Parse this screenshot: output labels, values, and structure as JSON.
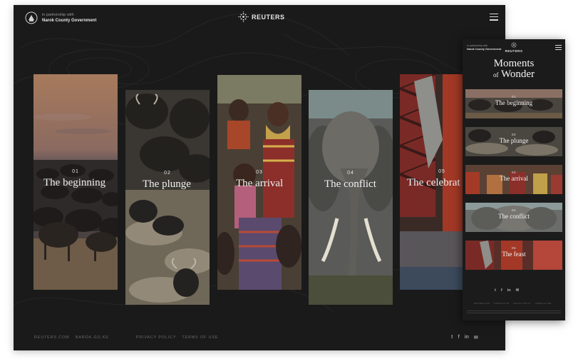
{
  "desktop": {
    "partner": {
      "line1": "in partnership with",
      "line2": "Narok County Government"
    },
    "brand": "REUTERS",
    "cards": [
      {
        "num": "01",
        "title": "The beginning"
      },
      {
        "num": "02",
        "title": "The plunge"
      },
      {
        "num": "03",
        "title": "The arrival"
      },
      {
        "num": "04",
        "title": "The conflict"
      },
      {
        "num": "05",
        "title": "The celebrat"
      }
    ],
    "footer": {
      "link1": "REUTERS.COM",
      "link2": "NAROK.GO.KE",
      "link3": "PRIVACY POLICY",
      "link4": "TERMS OF USE"
    },
    "social": {
      "twitter": "t",
      "facebook": "f",
      "linkedin": "in",
      "email": "✉"
    }
  },
  "mobile": {
    "partner": {
      "line1": "in partnership with",
      "line2": "Narok County Government"
    },
    "brand": "REUTERS",
    "title_line1": "Moments",
    "title_of": "of",
    "title_line2": "Wonder",
    "cards": [
      {
        "num": "01",
        "title": "The beginning"
      },
      {
        "num": "02",
        "title": "The plunge"
      },
      {
        "num": "03",
        "title": "The arrival"
      },
      {
        "num": "04",
        "title": "The conflict"
      },
      {
        "num": "05",
        "title": "The feast"
      }
    ],
    "social": {
      "twitter": "t",
      "facebook": "f",
      "linkedin": "in",
      "email": "✉"
    },
    "footer": {
      "link1": "REUTERS.COM",
      "link2": "NAROK.GO.KE",
      "link3": "PRIVACY POLICY",
      "link4": "TERMS OF USE"
    }
  }
}
